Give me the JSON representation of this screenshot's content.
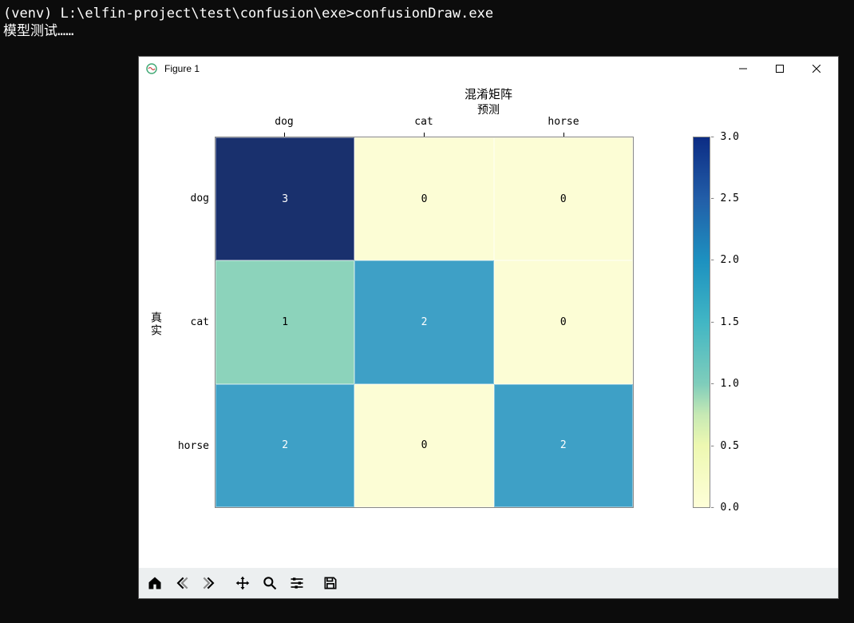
{
  "terminal": {
    "line1": "(venv) L:\\elfin-project\\test\\confusion\\exe>confusionDraw.exe",
    "line2": "模型测试……"
  },
  "window": {
    "title": "Figure 1"
  },
  "chart_data": {
    "type": "heatmap",
    "title": "混淆矩阵",
    "xlabel": "预测",
    "ylabel": "真实",
    "x_categories": [
      "dog",
      "cat",
      "horse"
    ],
    "y_categories": [
      "dog",
      "cat",
      "horse"
    ],
    "values": [
      [
        3,
        0,
        0
      ],
      [
        1,
        2,
        0
      ],
      [
        2,
        0,
        2
      ]
    ],
    "colorbar": {
      "min": 0.0,
      "max": 3.0,
      "ticks": [
        "3.0",
        "2.5",
        "2.0",
        "1.5",
        "1.0",
        "0.5",
        "0.0"
      ]
    },
    "cell_colors": [
      [
        "#19306d",
        "#fcfdd5",
        "#fcfdd5"
      ],
      [
        "#8cd3bb",
        "#3ea0c6",
        "#fcfdd5"
      ],
      [
        "#3ea0c6",
        "#fcfdd5",
        "#3ea0c6"
      ]
    ],
    "cell_text_colors": [
      [
        "#ffffff",
        "#000000",
        "#000000"
      ],
      [
        "#000000",
        "#ffffff",
        "#000000"
      ],
      [
        "#ffffff",
        "#000000",
        "#ffffff"
      ]
    ]
  },
  "toolbar": {
    "home": "Home",
    "back": "Back",
    "forward": "Forward",
    "pan": "Pan",
    "zoom": "Zoom",
    "configure": "Configure",
    "save": "Save"
  }
}
